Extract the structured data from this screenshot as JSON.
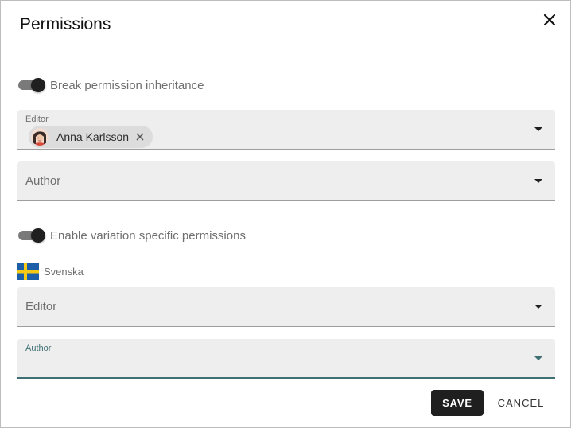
{
  "dialog": {
    "title": "Permissions",
    "close_icon": "close-icon"
  },
  "inheritance": {
    "label": "Break permission inheritance",
    "enabled": true
  },
  "editor_field": {
    "label": "Editor",
    "selected": [
      {
        "name": "Anna Karlsson",
        "avatar_icon": "user-avatar",
        "remove_icon": "remove-icon"
      }
    ]
  },
  "author_field": {
    "placeholder": "Author"
  },
  "variation": {
    "label": "Enable variation specific permissions",
    "enabled": true
  },
  "language": {
    "name": "Svenska",
    "flag_icon": "sweden-flag-icon"
  },
  "variation_editor_field": {
    "placeholder": "Editor"
  },
  "variation_author_field": {
    "label": "Author",
    "value": "",
    "focused": true
  },
  "actions": {
    "save_label": "SAVE",
    "cancel_label": "CANCEL"
  },
  "colors": {
    "accent": "#3d6f73",
    "primary_button": "#1f1f1f",
    "field_background": "#eeeeee",
    "text_muted": "#6f6f6f"
  }
}
